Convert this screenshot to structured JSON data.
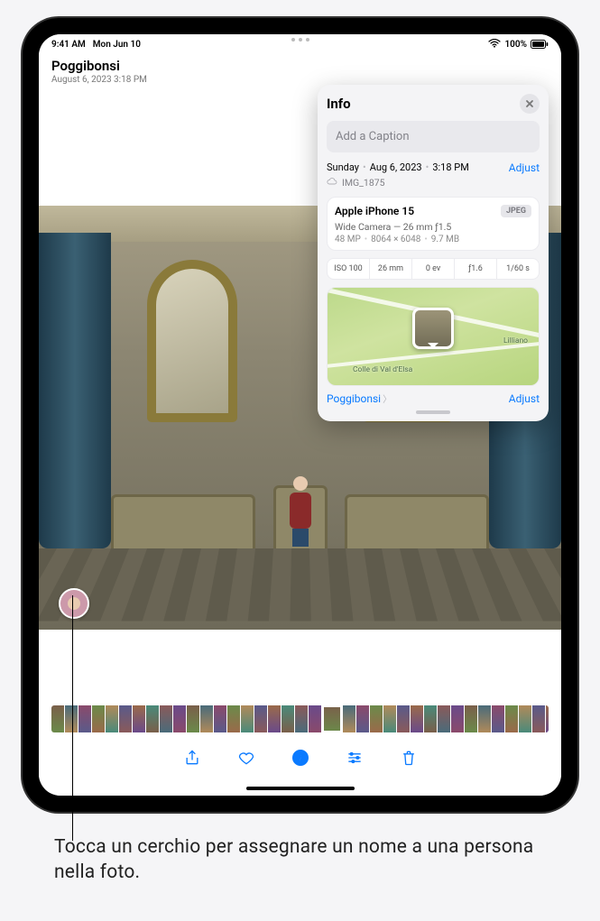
{
  "status_bar": {
    "time": "9:41 AM",
    "date": "Mon Jun 10",
    "battery_pct": "100%"
  },
  "header": {
    "location": "Poggibonsi",
    "datetime": "August 6, 2023   3:18 PM"
  },
  "info_panel": {
    "title": "Info",
    "caption_placeholder": "Add a Caption",
    "weekday": "Sunday",
    "date": "Aug 6, 2023",
    "time": "3:18 PM",
    "adjust_label": "Adjust",
    "filename": "IMG_1875",
    "device": "Apple iPhone 15",
    "format_badge": "JPEG",
    "lens": "Wide Camera — 26 mm ƒ1.5",
    "megapixels": "48 MP",
    "dimensions": "8064 × 6048",
    "filesize": "9.7 MB",
    "exif": {
      "iso": "ISO 100",
      "focal": "26 mm",
      "ev": "0 ev",
      "aperture": "ƒ1.6",
      "shutter": "1/60 s"
    },
    "map": {
      "label_colle": "Colle di\nVal d'Elsa",
      "label_lilliano": "Lilliano"
    },
    "location_link": "Poggibonsi",
    "location_adjust": "Adjust"
  },
  "toolbar": {
    "share": "Share",
    "favorite": "Favorite",
    "info": "Info",
    "adjust": "Adjust",
    "trash": "Delete"
  },
  "thumbnails": {
    "count": 40,
    "selected_index": 20
  },
  "callout": {
    "text": "Tocca un cerchio per assegnare un nome a una persona nella foto."
  }
}
